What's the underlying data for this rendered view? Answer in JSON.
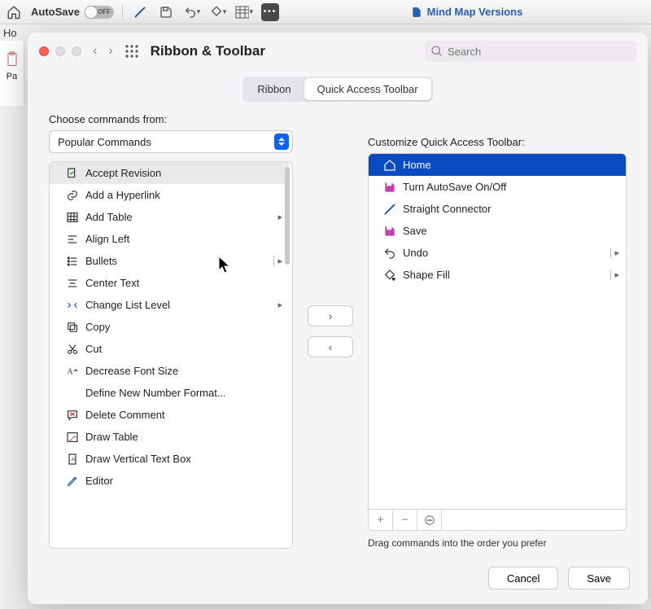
{
  "back": {
    "autosave_label": "AutoSave",
    "autosave_state": "OFF",
    "doc_title": "Mind Map Versions",
    "home_tab": "Ho",
    "panel_label": "Pa"
  },
  "sheet": {
    "title": "Ribbon & Toolbar",
    "search_placeholder": "Search"
  },
  "tabs": {
    "ribbon": "Ribbon",
    "qat": "Quick Access Toolbar"
  },
  "left": {
    "label": "Choose commands from:",
    "dropdown": "Popular Commands",
    "commands": [
      {
        "label": "Accept Revision",
        "submenu": false,
        "sel": true,
        "icon": "accept"
      },
      {
        "label": "Add a Hyperlink",
        "submenu": false,
        "icon": "link"
      },
      {
        "label": "Add Table",
        "submenu": true,
        "icon": "table"
      },
      {
        "label": "Align Left",
        "submenu": false,
        "icon": "align"
      },
      {
        "label": "Bullets",
        "submenu": true,
        "bar": true,
        "icon": "bullets"
      },
      {
        "label": "Center Text",
        "submenu": false,
        "icon": "center"
      },
      {
        "label": "Change List Level",
        "submenu": true,
        "icon": "listlevel"
      },
      {
        "label": "Copy",
        "submenu": false,
        "icon": "copy"
      },
      {
        "label": "Cut",
        "submenu": false,
        "icon": "cut"
      },
      {
        "label": "Decrease Font Size",
        "submenu": false,
        "icon": "fontdec"
      },
      {
        "label": "Define New Number Format...",
        "submenu": false,
        "icon": ""
      },
      {
        "label": "Delete Comment",
        "submenu": false,
        "icon": "delcomment"
      },
      {
        "label": "Draw Table",
        "submenu": false,
        "icon": "drawtable"
      },
      {
        "label": "Draw Vertical Text Box",
        "submenu": false,
        "icon": "vtextbox"
      },
      {
        "label": "Editor",
        "submenu": false,
        "icon": "editor"
      }
    ]
  },
  "right": {
    "label": "Customize Quick Access Toolbar:",
    "items": [
      {
        "label": "Home",
        "sel": true,
        "icon": "home",
        "color": "#fff"
      },
      {
        "label": "Turn AutoSave On/Off",
        "icon": "save",
        "color": "#c23fb3"
      },
      {
        "label": "Straight Connector",
        "icon": "line",
        "color": "#2a5db0"
      },
      {
        "label": "Save",
        "icon": "save",
        "color": "#c23fb3"
      },
      {
        "label": "Undo",
        "submenu": true,
        "icon": "undo",
        "color": "#333"
      },
      {
        "label": "Shape Fill",
        "submenu": true,
        "icon": "fill",
        "color": "#333"
      }
    ],
    "hint": "Drag commands into the order you prefer"
  },
  "footer": {
    "cancel": "Cancel",
    "save": "Save"
  }
}
